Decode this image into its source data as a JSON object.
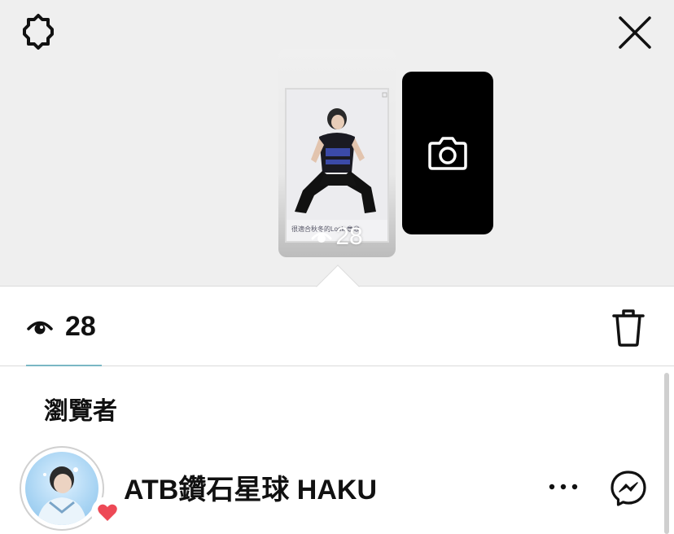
{
  "header": {
    "settings_icon": "gear-icon",
    "close_icon": "close-icon"
  },
  "story_preview": {
    "caption": "很適合秋冬的Look 😎😎",
    "view_count": "28",
    "view_icon": "eye-icon"
  },
  "camera_card": {
    "icon": "camera-icon"
  },
  "stats": {
    "view_count": "28",
    "view_icon": "eye-icon",
    "delete_icon": "trash-icon",
    "accent_color": "#7ab7c4"
  },
  "viewers": {
    "title": "瀏覽者",
    "items": [
      {
        "name": "ATB鑽石星球 HAKU",
        "liked": true,
        "heart_color": "#ed4956",
        "more_icon": "more-icon",
        "message_icon": "messenger-icon"
      }
    ]
  }
}
